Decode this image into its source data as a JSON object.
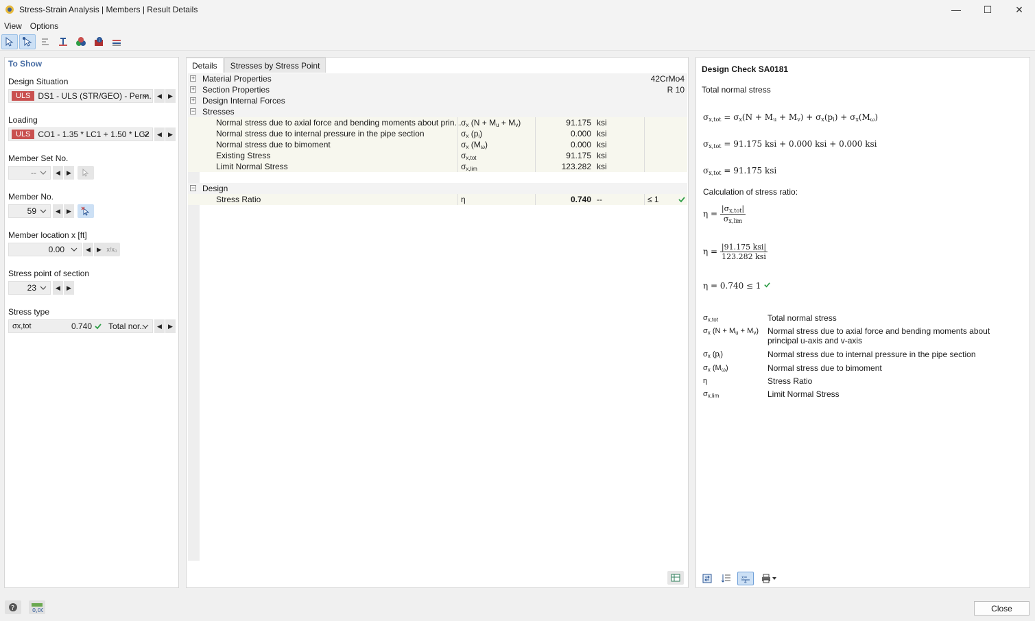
{
  "window": {
    "title": "Stress-Strain Analysis | Members | Result Details",
    "minimize": "—",
    "maximize": "☐",
    "close": "✕"
  },
  "menu": [
    "View",
    "Options"
  ],
  "left": {
    "title": "To Show",
    "design_situation": {
      "label": "Design Situation",
      "badge": "ULS",
      "value": "DS1 - ULS (STR/GEO) - Perm..."
    },
    "loading": {
      "label": "Loading",
      "badge": "ULS",
      "value": "CO1 - 1.35 * LC1 + 1.50 * LC2"
    },
    "member_set": {
      "label": "Member Set No.",
      "value": "--"
    },
    "member_no": {
      "label": "Member No.",
      "value": "59"
    },
    "member_location": {
      "label": "Member location x [ft]",
      "value": "0.00",
      "btn": "x/x₀"
    },
    "stress_point": {
      "label": "Stress point of section",
      "value": "23"
    },
    "stress_type": {
      "label": "Stress type",
      "symbol": "σx,tot",
      "value": "0.740",
      "desc": "Total nor..."
    }
  },
  "tabs": [
    "Details",
    "Stresses by Stress Point"
  ],
  "tree": {
    "material": {
      "label": "Material Properties",
      "value": "42CrMo4"
    },
    "section": {
      "label": "Section Properties",
      "value": "R 10"
    },
    "forces": {
      "label": "Design Internal Forces"
    },
    "stresses": {
      "label": "Stresses",
      "rows": [
        {
          "name": "Normal stress due to axial force and bending moments about prin...",
          "symbol": "σx (N + Mu + Mv)",
          "value": "91.175",
          "unit": "ksi"
        },
        {
          "name": "Normal stress due to internal pressure in the pipe section",
          "symbol": "σx (pi)",
          "value": "0.000",
          "unit": "ksi"
        },
        {
          "name": "Normal stress due to bimoment",
          "symbol": "σx (Mω)",
          "value": "0.000",
          "unit": "ksi"
        },
        {
          "name": "Existing Stress",
          "symbol": "σx,tot",
          "value": "91.175",
          "unit": "ksi"
        },
        {
          "name": "Limit Normal Stress",
          "symbol": "σx,lim",
          "value": "123.282",
          "unit": "ksi"
        }
      ]
    },
    "design": {
      "label": "Design",
      "row": {
        "name": "Stress Ratio",
        "symbol": "η",
        "value": "0.740",
        "unit": "--",
        "limit": "≤ 1"
      }
    }
  },
  "right": {
    "title": "Design Check SA0181",
    "subtitle": "Total normal stress",
    "eq1": "σx,tot = σx(N + Mu + Mv) + σx(pi) + σx(Mω)",
    "eq2": "σx,tot = 91.175 ksi + 0.000 ksi + 0.000 ksi",
    "eq3": "σx,tot = 91.175 ksi",
    "calc_label": "Calculation of stress ratio:",
    "eq4_lhs": "η =",
    "eq4_num": "|σx,tot|",
    "eq4_den": "σx,lim",
    "eq5_lhs": "η =",
    "eq5_num": "|91.175 ksi|",
    "eq5_den": "123.282 ksi",
    "eq6": "η = 0.740 ≤ 1",
    "legend": [
      {
        "sym": "σx,tot",
        "desc": "Total normal stress"
      },
      {
        "sym": "σx (N + Mu + Mv)",
        "desc": "Normal stress due to axial force and bending moments about principal u-axis and v-axis"
      },
      {
        "sym": "σx (pi)",
        "desc": "Normal stress due to internal pressure in the pipe section"
      },
      {
        "sym": "σx (Mω)",
        "desc": "Normal stress due to bimoment"
      },
      {
        "sym": "η",
        "desc": "Stress Ratio"
      },
      {
        "sym": "σx,lim",
        "desc": "Limit Normal Stress"
      }
    ]
  },
  "bottom": {
    "close_label": "Close"
  },
  "colors": {
    "accent": "#4a6fa5",
    "uls_badge": "#c9504f",
    "check": "#2e9e47"
  }
}
